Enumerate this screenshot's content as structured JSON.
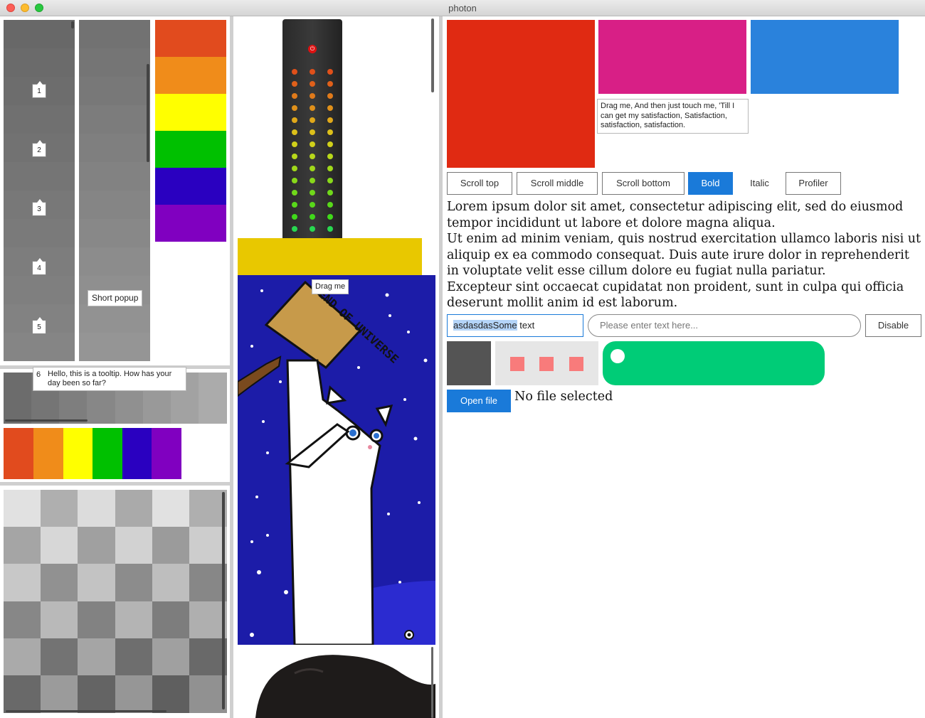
{
  "window": {
    "title": "photon"
  },
  "left_panel": {
    "badges": [
      "1",
      "2",
      "3",
      "4",
      "5"
    ],
    "short_popup": "Short popup",
    "tooltip_badge": "6",
    "tooltip_text": "Hello, this is a tooltip. How has your day been so far?",
    "rainbow_colors": [
      "#e14b1e",
      "#f08c1a",
      "#ffff00",
      "#00c000",
      "#2a00c0",
      "#8000c0"
    ]
  },
  "middle_panel": {
    "drag_label": "Drag me",
    "sign_text": "END OF UNIVERSE",
    "yellow_color": "#e8c800",
    "space_color": "#1c1ca8"
  },
  "right_panel": {
    "swatches": [
      "#e02a12",
      "#d81f86",
      "#2a82dc"
    ],
    "drag_tooltip": "Drag me, And then just touch me, 'Till I can get my satisfaction, Satisfaction, satisfaction, satisfaction.",
    "buttons": {
      "scroll_top": "Scroll top",
      "scroll_middle": "Scroll middle",
      "scroll_bottom": "Scroll bottom",
      "bold": "Bold",
      "italic": "Italic",
      "profiler": "Profiler"
    },
    "lorem": [
      "Lorem ipsum dolor sit amet, consectetur adipiscing elit, sed do eiusmod tempor incididunt ut labore et dolore magna aliqua.",
      "Ut enim ad minim veniam, quis nostrud exercitation ullamco laboris nisi ut aliquip ex ea commodo consequat. Duis aute irure dolor in reprehenderit in voluptate velit esse cillum dolore eu fugiat nulla pariatur.",
      "Excepteur sint occaecat cupidatat non proident, sunt in culpa qui officia deserunt mollit anim id est laborum."
    ],
    "text_input": {
      "selected": "asdasdasSome",
      "rest": " text"
    },
    "placeholder_input": {
      "placeholder": "Please enter text here..."
    },
    "disable_button": "Disable",
    "open_file_button": "Open file",
    "file_status": "No file selected",
    "toggle_color": "#00cc77"
  }
}
